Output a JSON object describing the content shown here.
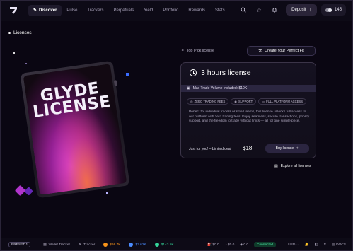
{
  "nav": {
    "items": [
      {
        "label": "Discover",
        "active": true
      },
      {
        "label": "Pulse"
      },
      {
        "label": "Trackers"
      },
      {
        "label": "Perpetuals"
      },
      {
        "label": "Yield"
      },
      {
        "label": "Portfolio"
      },
      {
        "label": "Rewards"
      },
      {
        "label": "Stats"
      }
    ],
    "deposit_label": "Deposit",
    "balance": "145"
  },
  "page": {
    "title": "Licenses"
  },
  "card": {
    "line1": "GLYDE",
    "line2": "LICENSE"
  },
  "offer": {
    "top_pick": "Top Pick license",
    "create_label": "Create Your Perfect Fit",
    "title": "3 hours license",
    "volume": "Max Trade Volume Included: $10K",
    "features": [
      "ZERO TRADING FEES",
      "SUPPORT",
      "FULL PLATFORM ACCESS"
    ],
    "description": "Perfect for individual traders or small teams, this license unlocks full access to our platform with zero trading fees. Enjoy seamless, secure transactions, priority support, and the freedom to trade without limits — all for one simple price.",
    "deal": "Just for you! – Limited deal",
    "price": "$18",
    "buy_label": "Buy license",
    "explore_label": "Explore all licenses"
  },
  "status": {
    "preset": "PRESET 1",
    "wallet_tracker": "Wallet Tracker",
    "x_tracker": "Tracker",
    "btc": "$98.7K",
    "eth": "$3.62K",
    "sol": "$143.5K",
    "fee1": "$0.0",
    "fee2": "$0.0",
    "fee3": "0.0",
    "connected": "Connected",
    "currency": "USD",
    "docs": "DOCS",
    "colors": {
      "btc": "#f7931a",
      "eth": "#4b8cff",
      "sol": "#35d59a"
    }
  }
}
